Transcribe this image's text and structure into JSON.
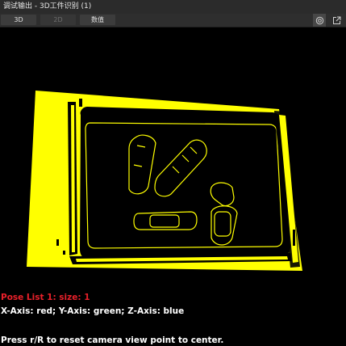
{
  "window": {
    "title": "调试输出 - 3D工件识别 (1)"
  },
  "tabs": [
    {
      "label": "3D",
      "enabled": true
    },
    {
      "label": "2D",
      "enabled": false
    },
    {
      "label": "数值",
      "enabled": true
    }
  ],
  "toolbar": {
    "icons": [
      "target-icon",
      "external-link-icon"
    ]
  },
  "viewer": {
    "pointcloud_color": "#ffff00",
    "background": "#000000",
    "pose_list": "Pose List 1: size: 1",
    "axes_legend": "X-Axis: red; Y-Axis: green; Z-Axis: blue",
    "reset_hint": "Press r/R to reset camera view point to center."
  }
}
